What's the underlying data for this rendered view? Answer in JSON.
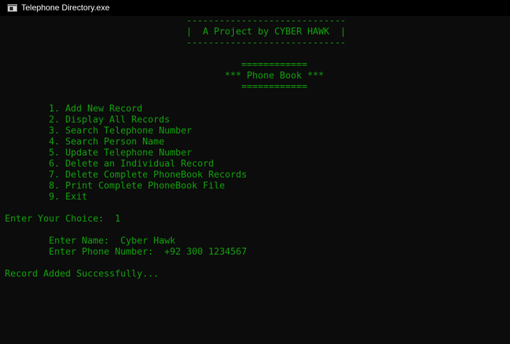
{
  "window": {
    "title": "Telephone Directory.exe",
    "icon": "console-app-icon"
  },
  "console": {
    "colors": {
      "background": "#0c0c0c",
      "text": "#13a10e",
      "titlebar": "#000000",
      "title_text": "#ffffff"
    },
    "banner": {
      "top_border": "-----------------------------",
      "text": "|  A Project by CYBER HAWK  |",
      "bottom_border": "-----------------------------"
    },
    "heading": {
      "top_rule": "============",
      "title": "*** Phone Book ***",
      "bottom_rule": "============"
    },
    "menu": [
      "1. Add New Record",
      "2. Display All Records",
      "3. Search Telephone Number",
      "4. Search Person Name",
      "5. Update Telephone Number",
      "6. Delete an Individual Record",
      "7. Delete Complete PhoneBook Records",
      "8. Print Complete PhoneBook File",
      "9. Exit"
    ],
    "choice_prompt": "Enter Your Choice:  1",
    "name_prompt": "Enter Name:  Cyber Hawk",
    "phone_prompt": "Enter Phone Number:  +92 300 1234567",
    "result_message": "Record Added Successfully..."
  }
}
